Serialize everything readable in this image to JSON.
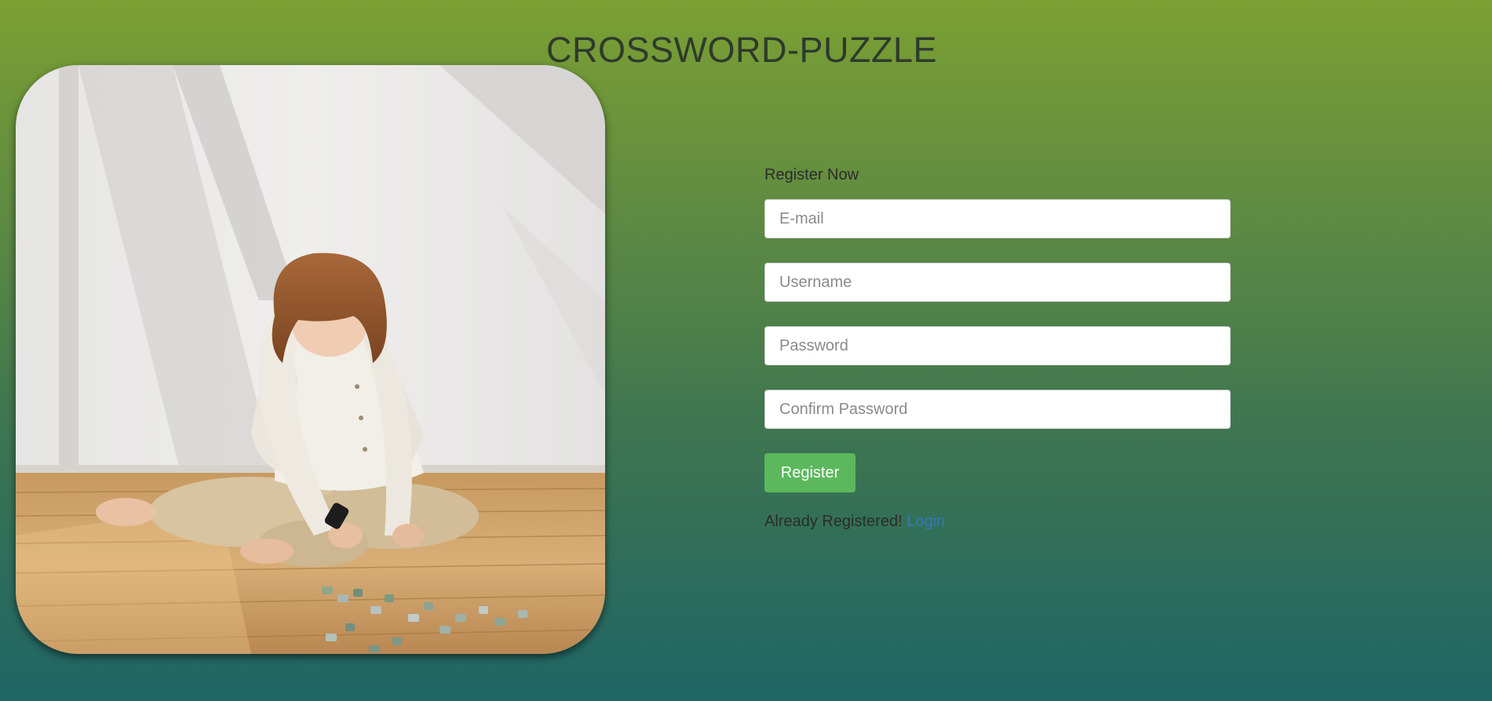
{
  "page": {
    "title": "CROSSWORD-PUZZLE"
  },
  "hero_image": {
    "subject": "child-solving-jigsaw-puzzle-photo"
  },
  "form": {
    "heading": "Register Now",
    "email_placeholder": "E-mail",
    "username_placeholder": "Username",
    "password_placeholder": "Password",
    "confirm_password_placeholder": "Confirm Password",
    "submit_label": "Register",
    "login_prompt": "Already Registered!",
    "login_link": "Login"
  },
  "colors": {
    "background_top": "#7ba033",
    "background_bottom": "#1f6566",
    "button": "#5cb85c",
    "link": "#337ab7"
  }
}
